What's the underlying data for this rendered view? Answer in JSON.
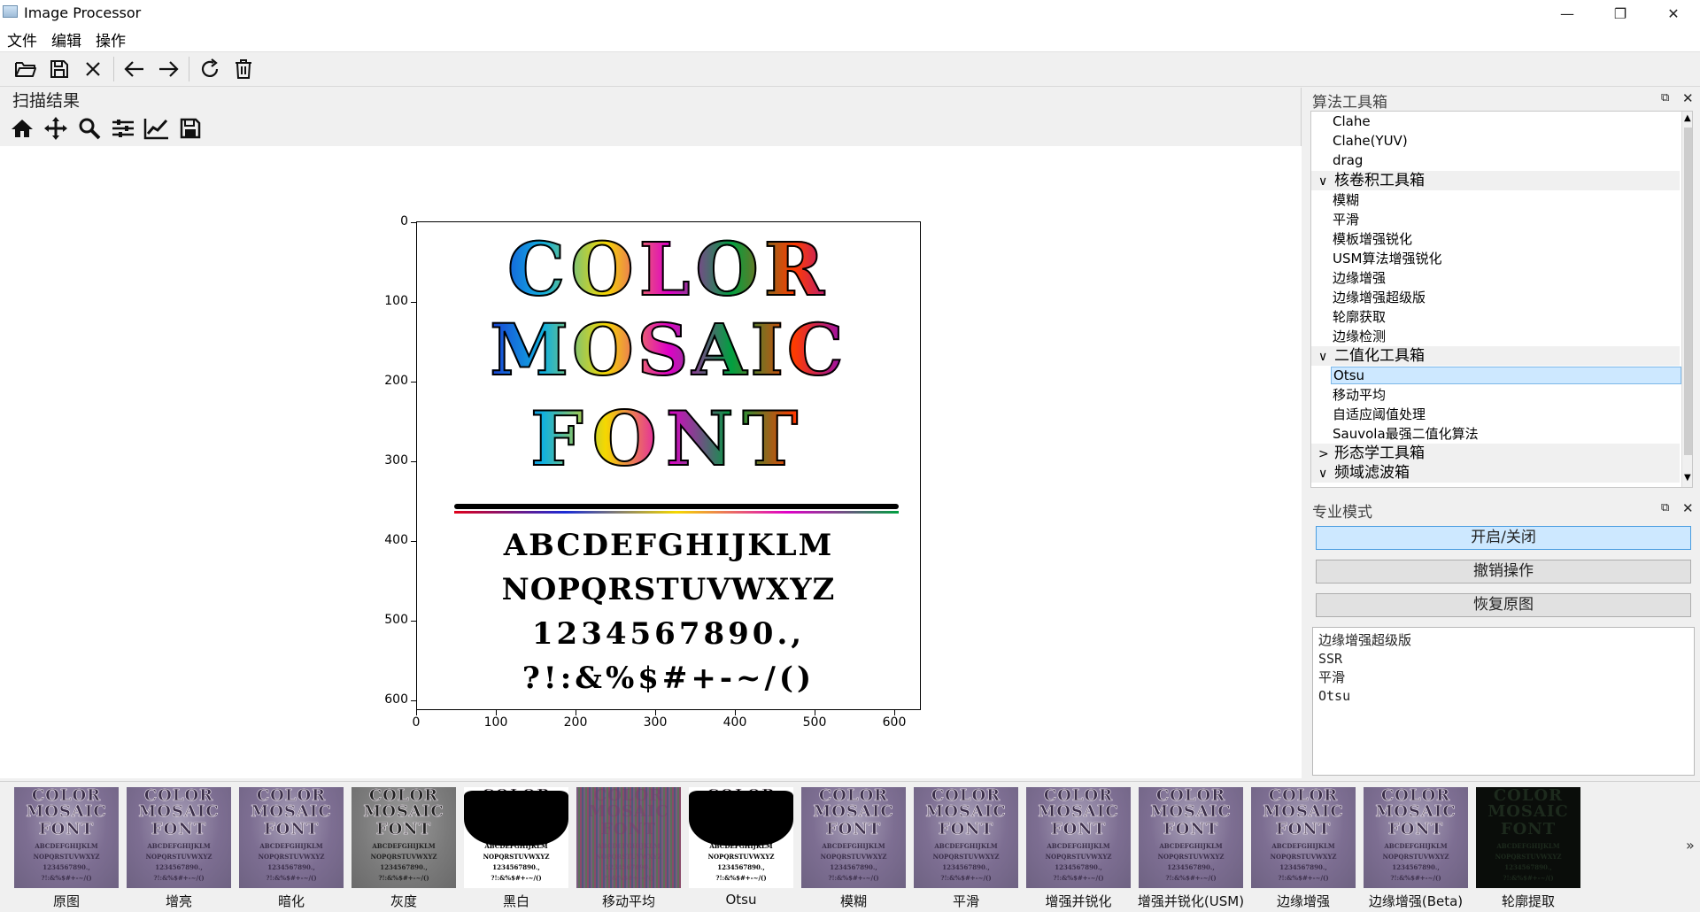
{
  "window": {
    "title": "Image Processor",
    "minimize": "—",
    "maximize": "❐",
    "close": "✕"
  },
  "menu": [
    "文件",
    "编辑",
    "操作"
  ],
  "left": {
    "title": "扫描结果"
  },
  "plot": {
    "y_ticks": [
      "0",
      "100",
      "200",
      "300",
      "400",
      "500",
      "600"
    ],
    "x_ticks": [
      "0",
      "100",
      "200",
      "300",
      "400",
      "500",
      "600"
    ],
    "image_lines": [
      "COLOR",
      "MOSAIC",
      "FONT"
    ],
    "char_lines": [
      "ABCDEFGHIJKLM",
      "NOPQRSTUVWXYZ",
      "1234567890.,",
      "?!:&%$#+-~/()"
    ]
  },
  "algo_dock": {
    "title": "算法工具箱",
    "float": "⧉",
    "close": "✕",
    "rows": [
      {
        "type": "leaf",
        "label": "Clahe"
      },
      {
        "type": "leaf",
        "label": "Clahe(YUV)"
      },
      {
        "type": "leaf",
        "label": "drag"
      },
      {
        "type": "group",
        "label": "核卷积工具箱",
        "arrow": "∨"
      },
      {
        "type": "leaf",
        "label": "模糊"
      },
      {
        "type": "leaf",
        "label": "平滑"
      },
      {
        "type": "leaf",
        "label": "模板增强锐化"
      },
      {
        "type": "leaf",
        "label": "USM算法增强锐化"
      },
      {
        "type": "leaf",
        "label": "边缘增强"
      },
      {
        "type": "leaf",
        "label": "边缘增强超级版"
      },
      {
        "type": "leaf",
        "label": "轮廓获取"
      },
      {
        "type": "leaf",
        "label": "边缘检测"
      },
      {
        "type": "group",
        "label": "二值化工具箱",
        "arrow": "∨"
      },
      {
        "type": "selected",
        "label": "Otsu"
      },
      {
        "type": "leaf",
        "label": "移动平均"
      },
      {
        "type": "leaf",
        "label": "自适应阈值处理"
      },
      {
        "type": "leaf",
        "label": "Sauvola最强二值化算法"
      },
      {
        "type": "group",
        "label": "形态学工具箱",
        "arrow": ">"
      },
      {
        "type": "group",
        "label": "频域滤波箱",
        "arrow": "∨"
      }
    ]
  },
  "pro_dock": {
    "title": "专业模式",
    "float": "⧉",
    "close": "✕",
    "toggle": "开启/关闭",
    "undo": "撤销操作",
    "restore": "恢复原图",
    "history": [
      "边缘增强超级版",
      "SSR",
      "平滑",
      "Otsu"
    ]
  },
  "thumbnails": [
    {
      "label": "原图",
      "style": "color"
    },
    {
      "label": "增亮",
      "style": "color"
    },
    {
      "label": "暗化",
      "style": "color"
    },
    {
      "label": "灰度",
      "style": "gray"
    },
    {
      "label": "黑白",
      "style": "bw"
    },
    {
      "label": "移动平均",
      "style": "noise"
    },
    {
      "label": "Otsu",
      "style": "bw"
    },
    {
      "label": "模糊",
      "style": "color"
    },
    {
      "label": "平滑",
      "style": "color"
    },
    {
      "label": "增强并锐化",
      "style": "color"
    },
    {
      "label": "增强并锐化(USM)",
      "style": "color"
    },
    {
      "label": "边缘增强",
      "style": "color"
    },
    {
      "label": "边缘增强(Beta)",
      "style": "color"
    },
    {
      "label": "轮廓提取",
      "style": "dark"
    }
  ],
  "thumb_text": [
    "COLOR",
    "MOSAIC",
    "FONT",
    "ABCDEFGHIJKLM",
    "NOPQRSTUVWXYZ",
    "1234567890.,",
    "?!:&%$#+-~/()"
  ],
  "strip_more": "»"
}
